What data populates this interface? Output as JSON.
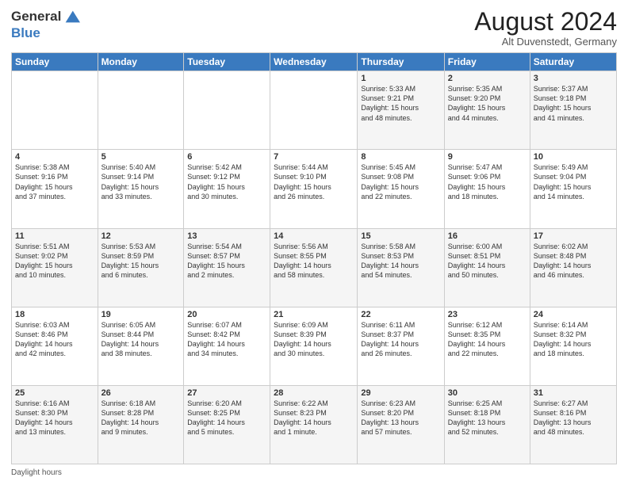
{
  "header": {
    "logo_line1": "General",
    "logo_line2": "Blue",
    "month_year": "August 2024",
    "location": "Alt Duvenstedt, Germany"
  },
  "days_of_week": [
    "Sunday",
    "Monday",
    "Tuesday",
    "Wednesday",
    "Thursday",
    "Friday",
    "Saturday"
  ],
  "weeks": [
    [
      {
        "day": "",
        "info": ""
      },
      {
        "day": "",
        "info": ""
      },
      {
        "day": "",
        "info": ""
      },
      {
        "day": "",
        "info": ""
      },
      {
        "day": "1",
        "info": "Sunrise: 5:33 AM\nSunset: 9:21 PM\nDaylight: 15 hours\nand 48 minutes."
      },
      {
        "day": "2",
        "info": "Sunrise: 5:35 AM\nSunset: 9:20 PM\nDaylight: 15 hours\nand 44 minutes."
      },
      {
        "day": "3",
        "info": "Sunrise: 5:37 AM\nSunset: 9:18 PM\nDaylight: 15 hours\nand 41 minutes."
      }
    ],
    [
      {
        "day": "4",
        "info": "Sunrise: 5:38 AM\nSunset: 9:16 PM\nDaylight: 15 hours\nand 37 minutes."
      },
      {
        "day": "5",
        "info": "Sunrise: 5:40 AM\nSunset: 9:14 PM\nDaylight: 15 hours\nand 33 minutes."
      },
      {
        "day": "6",
        "info": "Sunrise: 5:42 AM\nSunset: 9:12 PM\nDaylight: 15 hours\nand 30 minutes."
      },
      {
        "day": "7",
        "info": "Sunrise: 5:44 AM\nSunset: 9:10 PM\nDaylight: 15 hours\nand 26 minutes."
      },
      {
        "day": "8",
        "info": "Sunrise: 5:45 AM\nSunset: 9:08 PM\nDaylight: 15 hours\nand 22 minutes."
      },
      {
        "day": "9",
        "info": "Sunrise: 5:47 AM\nSunset: 9:06 PM\nDaylight: 15 hours\nand 18 minutes."
      },
      {
        "day": "10",
        "info": "Sunrise: 5:49 AM\nSunset: 9:04 PM\nDaylight: 15 hours\nand 14 minutes."
      }
    ],
    [
      {
        "day": "11",
        "info": "Sunrise: 5:51 AM\nSunset: 9:02 PM\nDaylight: 15 hours\nand 10 minutes."
      },
      {
        "day": "12",
        "info": "Sunrise: 5:53 AM\nSunset: 8:59 PM\nDaylight: 15 hours\nand 6 minutes."
      },
      {
        "day": "13",
        "info": "Sunrise: 5:54 AM\nSunset: 8:57 PM\nDaylight: 15 hours\nand 2 minutes."
      },
      {
        "day": "14",
        "info": "Sunrise: 5:56 AM\nSunset: 8:55 PM\nDaylight: 14 hours\nand 58 minutes."
      },
      {
        "day": "15",
        "info": "Sunrise: 5:58 AM\nSunset: 8:53 PM\nDaylight: 14 hours\nand 54 minutes."
      },
      {
        "day": "16",
        "info": "Sunrise: 6:00 AM\nSunset: 8:51 PM\nDaylight: 14 hours\nand 50 minutes."
      },
      {
        "day": "17",
        "info": "Sunrise: 6:02 AM\nSunset: 8:48 PM\nDaylight: 14 hours\nand 46 minutes."
      }
    ],
    [
      {
        "day": "18",
        "info": "Sunrise: 6:03 AM\nSunset: 8:46 PM\nDaylight: 14 hours\nand 42 minutes."
      },
      {
        "day": "19",
        "info": "Sunrise: 6:05 AM\nSunset: 8:44 PM\nDaylight: 14 hours\nand 38 minutes."
      },
      {
        "day": "20",
        "info": "Sunrise: 6:07 AM\nSunset: 8:42 PM\nDaylight: 14 hours\nand 34 minutes."
      },
      {
        "day": "21",
        "info": "Sunrise: 6:09 AM\nSunset: 8:39 PM\nDaylight: 14 hours\nand 30 minutes."
      },
      {
        "day": "22",
        "info": "Sunrise: 6:11 AM\nSunset: 8:37 PM\nDaylight: 14 hours\nand 26 minutes."
      },
      {
        "day": "23",
        "info": "Sunrise: 6:12 AM\nSunset: 8:35 PM\nDaylight: 14 hours\nand 22 minutes."
      },
      {
        "day": "24",
        "info": "Sunrise: 6:14 AM\nSunset: 8:32 PM\nDaylight: 14 hours\nand 18 minutes."
      }
    ],
    [
      {
        "day": "25",
        "info": "Sunrise: 6:16 AM\nSunset: 8:30 PM\nDaylight: 14 hours\nand 13 minutes."
      },
      {
        "day": "26",
        "info": "Sunrise: 6:18 AM\nSunset: 8:28 PM\nDaylight: 14 hours\nand 9 minutes."
      },
      {
        "day": "27",
        "info": "Sunrise: 6:20 AM\nSunset: 8:25 PM\nDaylight: 14 hours\nand 5 minutes."
      },
      {
        "day": "28",
        "info": "Sunrise: 6:22 AM\nSunset: 8:23 PM\nDaylight: 14 hours\nand 1 minute."
      },
      {
        "day": "29",
        "info": "Sunrise: 6:23 AM\nSunset: 8:20 PM\nDaylight: 13 hours\nand 57 minutes."
      },
      {
        "day": "30",
        "info": "Sunrise: 6:25 AM\nSunset: 8:18 PM\nDaylight: 13 hours\nand 52 minutes."
      },
      {
        "day": "31",
        "info": "Sunrise: 6:27 AM\nSunset: 8:16 PM\nDaylight: 13 hours\nand 48 minutes."
      }
    ]
  ],
  "footer": {
    "daylight_label": "Daylight hours"
  }
}
